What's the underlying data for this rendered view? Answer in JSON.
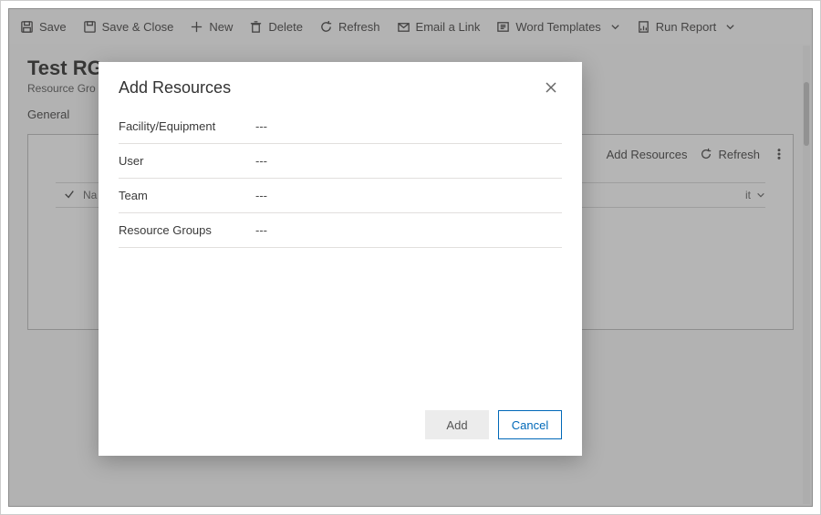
{
  "toolbar": {
    "save": "Save",
    "save_close": "Save & Close",
    "new": "New",
    "delete": "Delete",
    "refresh": "Refresh",
    "email_link": "Email a Link",
    "word_templates": "Word Templates",
    "run_report": "Run Report"
  },
  "page": {
    "title": "Test RG",
    "subtitle": "Resource Gro",
    "tab_general": "General"
  },
  "grid": {
    "col_name": "Na",
    "add_resources": "Add Resources",
    "refresh": "Refresh",
    "other_col": "it"
  },
  "modal": {
    "title": "Add Resources",
    "fields": {
      "facility": {
        "label": "Facility/Equipment",
        "value": "---"
      },
      "user": {
        "label": "User",
        "value": "---"
      },
      "team": {
        "label": "Team",
        "value": "---"
      },
      "resource_groups": {
        "label": "Resource Groups",
        "value": "---"
      }
    },
    "add": "Add",
    "cancel": "Cancel"
  }
}
